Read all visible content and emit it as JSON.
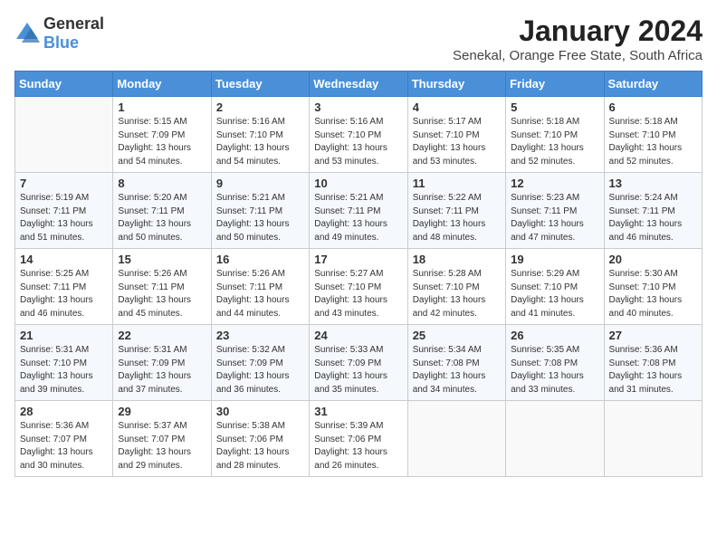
{
  "logo": {
    "general": "General",
    "blue": "Blue"
  },
  "title": "January 2024",
  "location": "Senekal, Orange Free State, South Africa",
  "days_header": [
    "Sunday",
    "Monday",
    "Tuesday",
    "Wednesday",
    "Thursday",
    "Friday",
    "Saturday"
  ],
  "weeks": [
    [
      {
        "day": "",
        "info": ""
      },
      {
        "day": "1",
        "info": "Sunrise: 5:15 AM\nSunset: 7:09 PM\nDaylight: 13 hours\nand 54 minutes."
      },
      {
        "day": "2",
        "info": "Sunrise: 5:16 AM\nSunset: 7:10 PM\nDaylight: 13 hours\nand 54 minutes."
      },
      {
        "day": "3",
        "info": "Sunrise: 5:16 AM\nSunset: 7:10 PM\nDaylight: 13 hours\nand 53 minutes."
      },
      {
        "day": "4",
        "info": "Sunrise: 5:17 AM\nSunset: 7:10 PM\nDaylight: 13 hours\nand 53 minutes."
      },
      {
        "day": "5",
        "info": "Sunrise: 5:18 AM\nSunset: 7:10 PM\nDaylight: 13 hours\nand 52 minutes."
      },
      {
        "day": "6",
        "info": "Sunrise: 5:18 AM\nSunset: 7:10 PM\nDaylight: 13 hours\nand 52 minutes."
      }
    ],
    [
      {
        "day": "7",
        "info": "Sunrise: 5:19 AM\nSunset: 7:11 PM\nDaylight: 13 hours\nand 51 minutes."
      },
      {
        "day": "8",
        "info": "Sunrise: 5:20 AM\nSunset: 7:11 PM\nDaylight: 13 hours\nand 50 minutes."
      },
      {
        "day": "9",
        "info": "Sunrise: 5:21 AM\nSunset: 7:11 PM\nDaylight: 13 hours\nand 50 minutes."
      },
      {
        "day": "10",
        "info": "Sunrise: 5:21 AM\nSunset: 7:11 PM\nDaylight: 13 hours\nand 49 minutes."
      },
      {
        "day": "11",
        "info": "Sunrise: 5:22 AM\nSunset: 7:11 PM\nDaylight: 13 hours\nand 48 minutes."
      },
      {
        "day": "12",
        "info": "Sunrise: 5:23 AM\nSunset: 7:11 PM\nDaylight: 13 hours\nand 47 minutes."
      },
      {
        "day": "13",
        "info": "Sunrise: 5:24 AM\nSunset: 7:11 PM\nDaylight: 13 hours\nand 46 minutes."
      }
    ],
    [
      {
        "day": "14",
        "info": "Sunrise: 5:25 AM\nSunset: 7:11 PM\nDaylight: 13 hours\nand 46 minutes."
      },
      {
        "day": "15",
        "info": "Sunrise: 5:26 AM\nSunset: 7:11 PM\nDaylight: 13 hours\nand 45 minutes."
      },
      {
        "day": "16",
        "info": "Sunrise: 5:26 AM\nSunset: 7:11 PM\nDaylight: 13 hours\nand 44 minutes."
      },
      {
        "day": "17",
        "info": "Sunrise: 5:27 AM\nSunset: 7:10 PM\nDaylight: 13 hours\nand 43 minutes."
      },
      {
        "day": "18",
        "info": "Sunrise: 5:28 AM\nSunset: 7:10 PM\nDaylight: 13 hours\nand 42 minutes."
      },
      {
        "day": "19",
        "info": "Sunrise: 5:29 AM\nSunset: 7:10 PM\nDaylight: 13 hours\nand 41 minutes."
      },
      {
        "day": "20",
        "info": "Sunrise: 5:30 AM\nSunset: 7:10 PM\nDaylight: 13 hours\nand 40 minutes."
      }
    ],
    [
      {
        "day": "21",
        "info": "Sunrise: 5:31 AM\nSunset: 7:10 PM\nDaylight: 13 hours\nand 39 minutes."
      },
      {
        "day": "22",
        "info": "Sunrise: 5:31 AM\nSunset: 7:09 PM\nDaylight: 13 hours\nand 37 minutes."
      },
      {
        "day": "23",
        "info": "Sunrise: 5:32 AM\nSunset: 7:09 PM\nDaylight: 13 hours\nand 36 minutes."
      },
      {
        "day": "24",
        "info": "Sunrise: 5:33 AM\nSunset: 7:09 PM\nDaylight: 13 hours\nand 35 minutes."
      },
      {
        "day": "25",
        "info": "Sunrise: 5:34 AM\nSunset: 7:08 PM\nDaylight: 13 hours\nand 34 minutes."
      },
      {
        "day": "26",
        "info": "Sunrise: 5:35 AM\nSunset: 7:08 PM\nDaylight: 13 hours\nand 33 minutes."
      },
      {
        "day": "27",
        "info": "Sunrise: 5:36 AM\nSunset: 7:08 PM\nDaylight: 13 hours\nand 31 minutes."
      }
    ],
    [
      {
        "day": "28",
        "info": "Sunrise: 5:36 AM\nSunset: 7:07 PM\nDaylight: 13 hours\nand 30 minutes."
      },
      {
        "day": "29",
        "info": "Sunrise: 5:37 AM\nSunset: 7:07 PM\nDaylight: 13 hours\nand 29 minutes."
      },
      {
        "day": "30",
        "info": "Sunrise: 5:38 AM\nSunset: 7:06 PM\nDaylight: 13 hours\nand 28 minutes."
      },
      {
        "day": "31",
        "info": "Sunrise: 5:39 AM\nSunset: 7:06 PM\nDaylight: 13 hours\nand 26 minutes."
      },
      {
        "day": "",
        "info": ""
      },
      {
        "day": "",
        "info": ""
      },
      {
        "day": "",
        "info": ""
      }
    ]
  ]
}
